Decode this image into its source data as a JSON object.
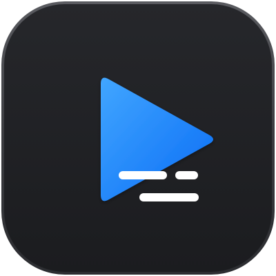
{
  "icon": {
    "name": "video-captions-app-icon",
    "tile_color": "#1E1F22",
    "tile_edge_color": "#3A3B3F",
    "play_gradient_start": "#41A6FF",
    "play_gradient_end": "#0A6CF5",
    "caption_line_color": "#FFFFFF"
  }
}
